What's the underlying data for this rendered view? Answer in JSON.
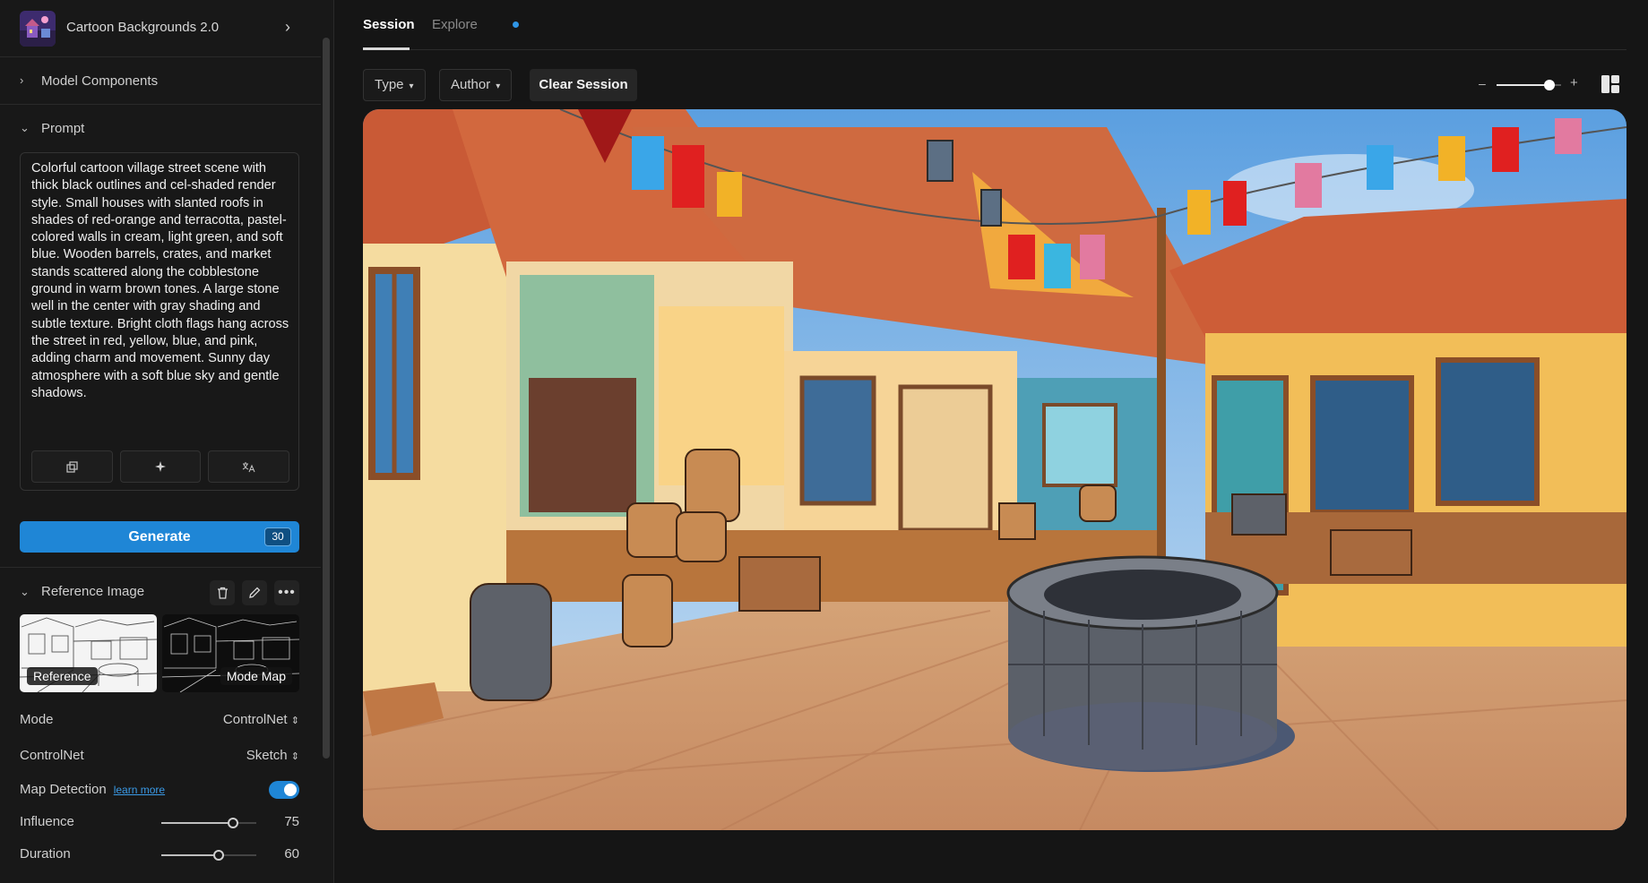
{
  "sidebar": {
    "model": {
      "name": "Cartoon Backgrounds 2.0",
      "thumb_icon": "model-thumbnail",
      "chevron_icon": "chevron-right-icon"
    },
    "sections": {
      "model_components": {
        "label": "Model Components",
        "icon": "chevron-right-icon"
      },
      "prompt": {
        "label": "Prompt",
        "icon": "chevron-down-icon"
      }
    },
    "prompt": {
      "text": "Colorful cartoon village street scene with thick black outlines and cel-shaded render style. Small houses with slanted roofs in shades of red-orange and terracotta, pastel-colored walls in cream, light green, and soft blue. Wooden barrels, crates, and market stands scattered along the cobblestone ground in warm brown tones. A large stone well in the center with gray shading and subtle texture. Bright cloth flags hang across the street in red, yellow, blue, and pink, adding charm and movement. Sunny day atmosphere with a soft blue sky and gentle shadows.",
      "tools": [
        "copy-icon",
        "magic-enhance-icon",
        "translate-icon"
      ]
    },
    "generate": {
      "label": "Generate",
      "count": "30"
    },
    "reference_image": {
      "label": "Reference Image",
      "actions": [
        "trash-icon",
        "edit-pencil-icon",
        "more-icon"
      ],
      "thumbs": [
        {
          "tag": "Reference"
        },
        {
          "tag": "Mode Map"
        }
      ]
    },
    "params": {
      "mode": {
        "label": "Mode",
        "value": "ControlNet"
      },
      "controlnet": {
        "label": "ControlNet",
        "value": "Sketch"
      },
      "map_detection": {
        "label": "Map Detection",
        "link": "learn more",
        "enabled": true
      },
      "influence": {
        "label": "Influence",
        "value": "75",
        "level": 0.75
      },
      "duration": {
        "label": "Duration",
        "value": "60",
        "level": 0.6
      }
    }
  },
  "main": {
    "tabs": [
      {
        "label": "Session",
        "active": true
      },
      {
        "label": "Explore",
        "active": false,
        "has_dot": true
      }
    ],
    "filters": {
      "type": "Type",
      "author": "Author",
      "clear": "Clear Session"
    },
    "zoom": {
      "minus": "–",
      "plus": "+",
      "level": 0.82
    },
    "layout_icon": "grid-layout-icon",
    "image": {
      "subject": "cartoon-village-street"
    }
  },
  "colors": {
    "accent": "#1f86d6",
    "bg": "#151515",
    "sidebar": "#181818"
  }
}
